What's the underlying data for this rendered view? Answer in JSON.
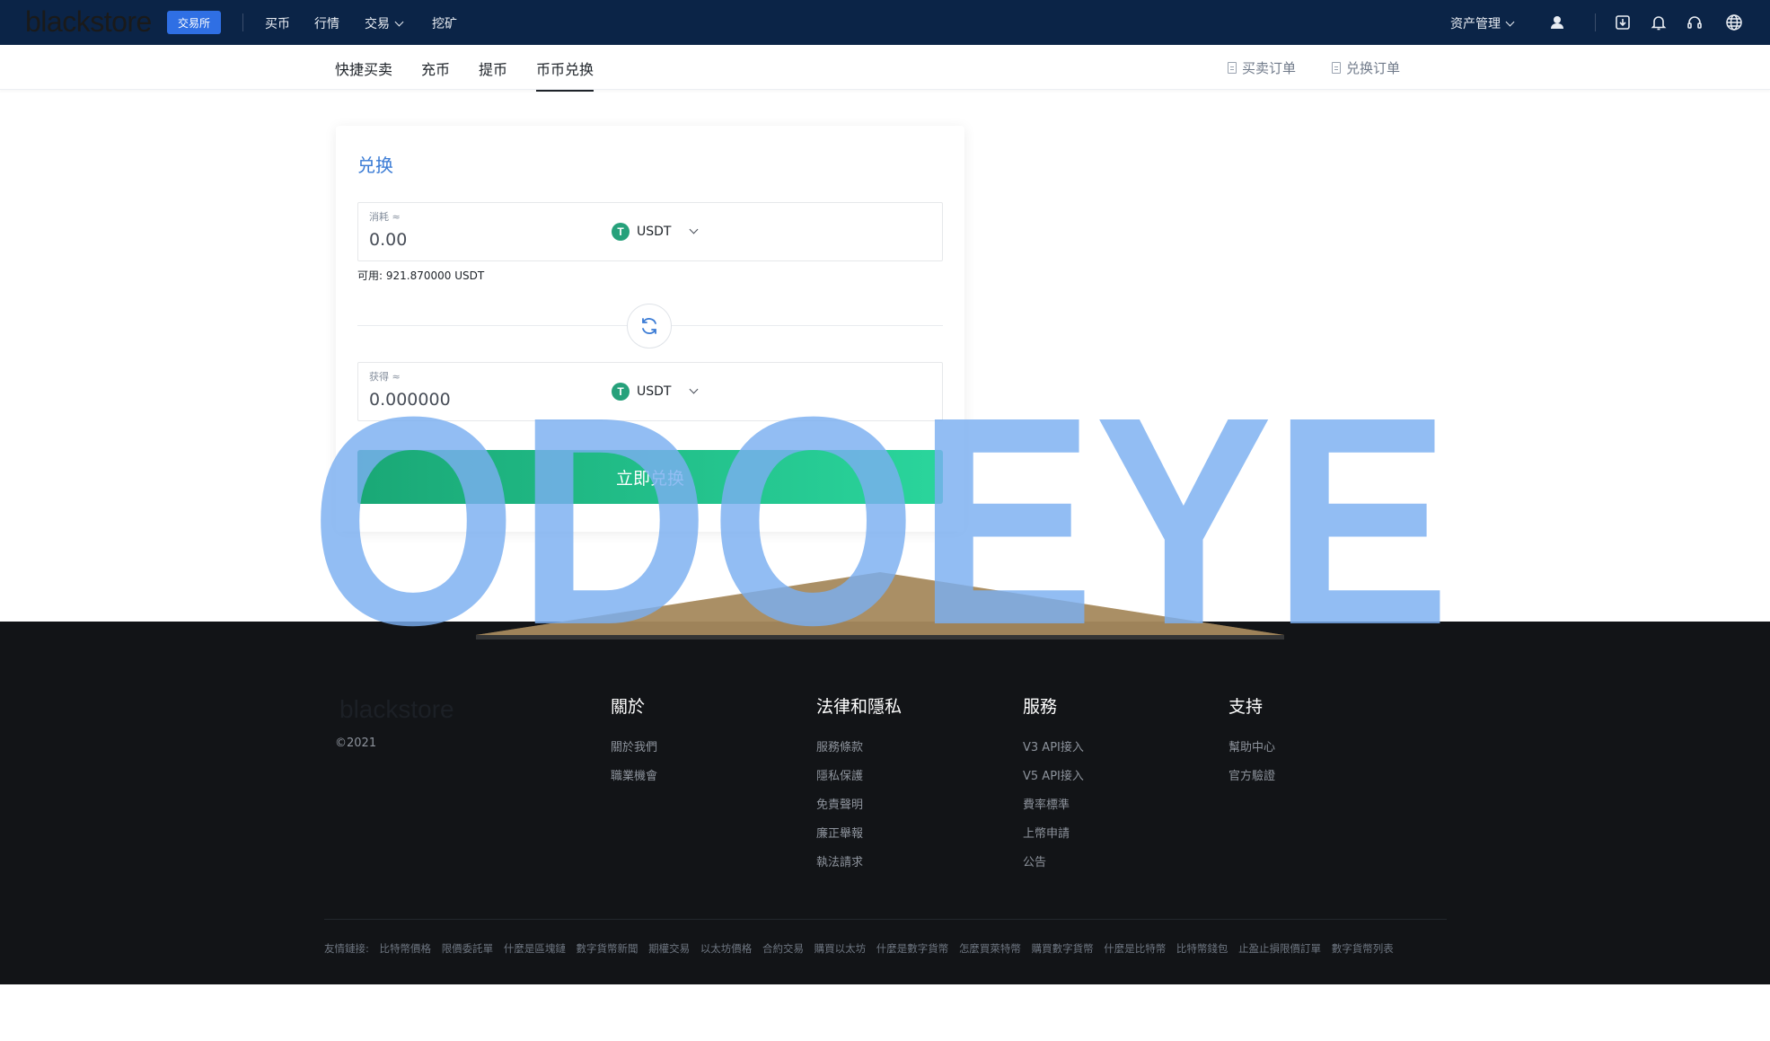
{
  "header": {
    "logo": "blackstore",
    "exchange_badge": "交易所",
    "nav": [
      {
        "label": "买币"
      },
      {
        "label": "行情"
      },
      {
        "label": "交易"
      },
      {
        "label": "挖矿"
      }
    ],
    "asset_menu": "资产管理"
  },
  "subnav": {
    "tabs": [
      {
        "label": "快捷买卖"
      },
      {
        "label": "充币"
      },
      {
        "label": "提币"
      },
      {
        "label": "币币兑换",
        "active": true
      }
    ],
    "buy_sell_orders": "买卖订单",
    "exchange_orders": "兑换订单"
  },
  "exchange_card": {
    "title": "兑换",
    "from": {
      "label": "消耗 ≈",
      "value": "0.00",
      "coin": "USDT"
    },
    "available": "可用: 921.870000 USDT",
    "to": {
      "label": "获得 ≈",
      "value": "0.000000",
      "coin": "USDT"
    },
    "submit": "立即兑换"
  },
  "footer": {
    "logo": "blackstore",
    "copyright": "©2021",
    "columns": [
      {
        "title": "關於",
        "links": [
          "關於我們",
          "職業機會"
        ]
      },
      {
        "title": "法律和隱私",
        "links": [
          "服務條款",
          "隱私保護",
          "免責聲明",
          "廉正舉報",
          "執法請求"
        ]
      },
      {
        "title": "服務",
        "links": [
          "V3 API接入",
          "V5 API接入",
          "費率標準",
          "上幣申請",
          "公告"
        ]
      },
      {
        "title": "支持",
        "links": [
          "幫助中心",
          "官方驗證"
        ]
      }
    ],
    "friends_label": "友情鏈接:",
    "friends_links": [
      "比特幣價格",
      "限價委託單",
      "什麼是區塊鏈",
      "數字貨幣新聞",
      "期權交易",
      "以太坊價格",
      "合約交易",
      "購買以太坊",
      "什麼是數字貨幣",
      "怎麼買萊特幣",
      "購買數字貨幣",
      "什麼是比特幣",
      "比特幣錢包",
      "止盈止損限價訂單",
      "數字貨幣列表"
    ]
  },
  "watermark": {
    "text": "ODOEYE"
  },
  "colors": {
    "topbar": "#0b2447",
    "badge": "#2f6fe4",
    "accent_title": "#3a7bd5",
    "cta_start": "#1aa876",
    "cta_end": "#2ad59c",
    "usdt": "#26a17b",
    "footer_bg": "#121417"
  }
}
